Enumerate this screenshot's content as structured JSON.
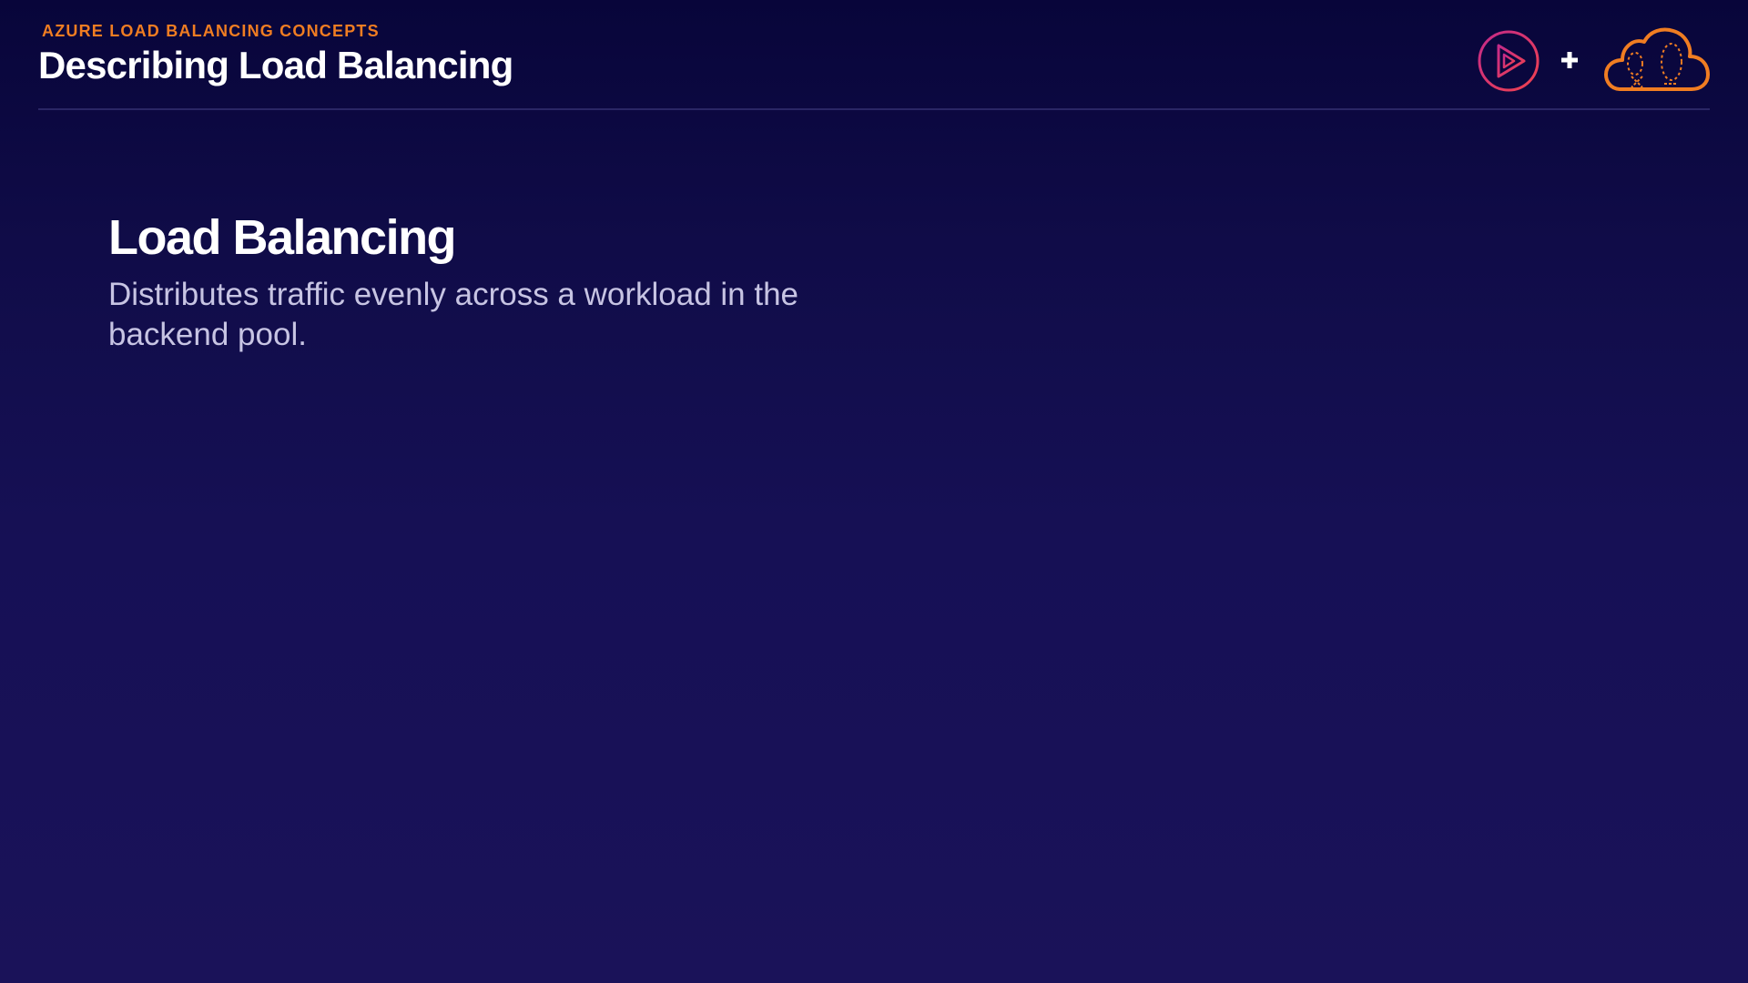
{
  "header": {
    "eyebrow": "AZURE LOAD BALANCING CONCEPTS",
    "title": "Describing Load Balancing"
  },
  "logos": {
    "play_icon": "play-circle-logo",
    "plus_icon": "plus-icon",
    "cloud_icon": "cloud-logo"
  },
  "content": {
    "heading": "Load Balancing",
    "body": "Distributes traffic evenly across a workload in the backend pool."
  },
  "colors": {
    "accent_orange": "#f07d22",
    "accent_pink": "#e8336c",
    "background_top": "#08053a",
    "background_bottom": "#1a1259",
    "body_text": "#c7c4e3"
  }
}
